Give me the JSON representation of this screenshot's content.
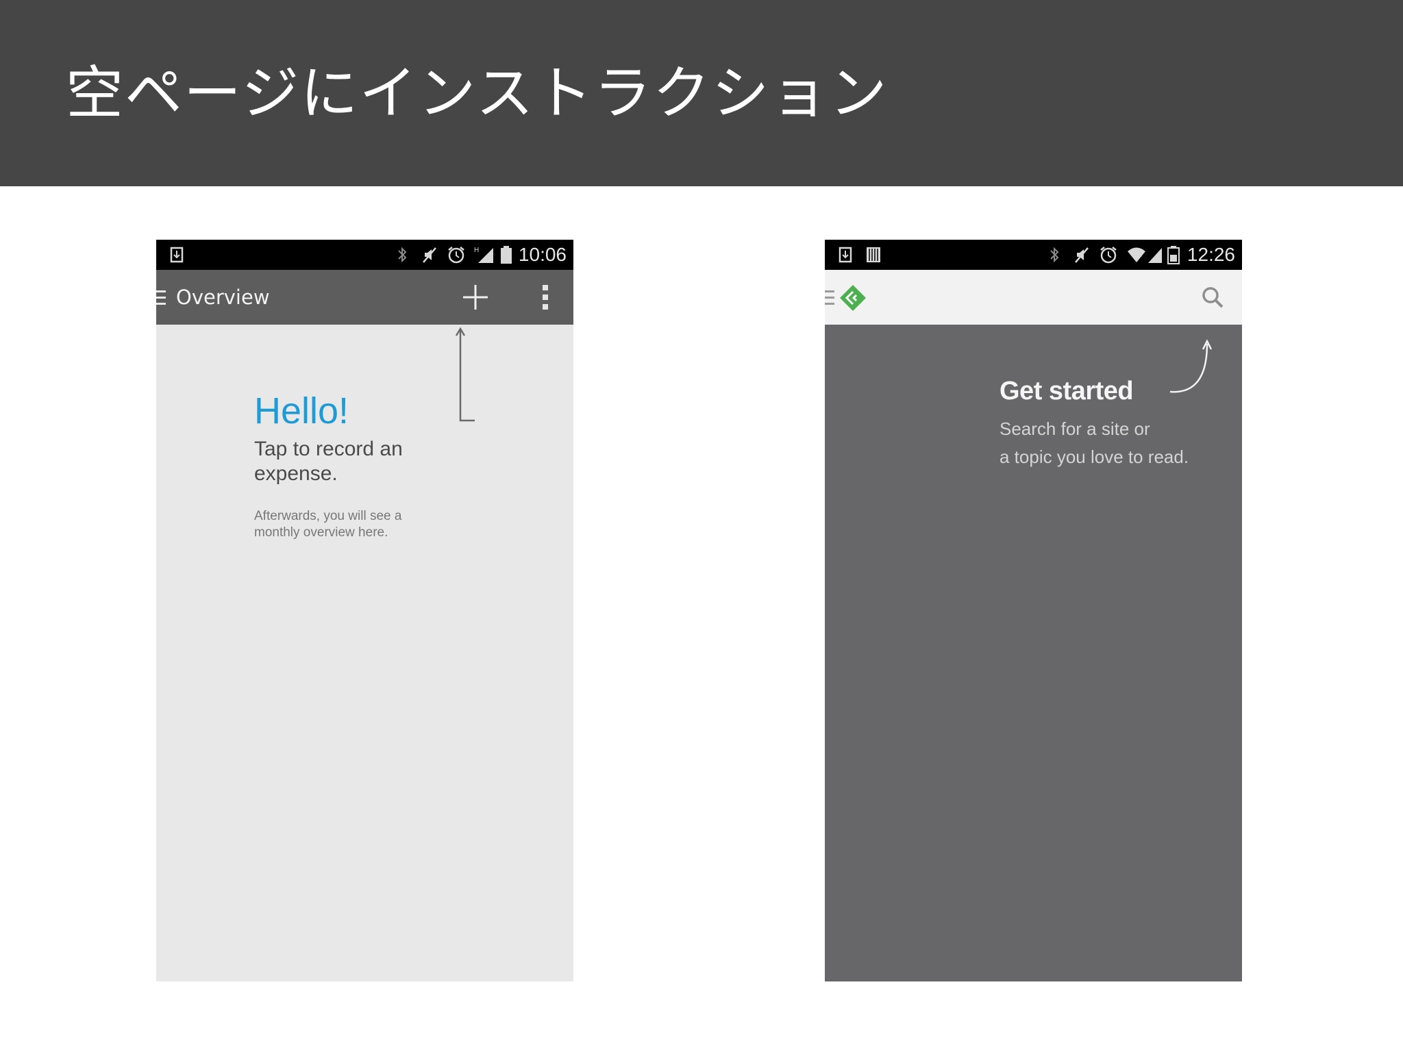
{
  "slide": {
    "title": "空ページにインストラクション",
    "header_bg": "#464646"
  },
  "left_phone": {
    "status_time": "10:06",
    "action_bar_title": "Overview",
    "icons": [
      "menu-icon",
      "plus-icon",
      "overflow-menu-icon",
      "download-icon",
      "bluetooth-icon",
      "mute-icon",
      "alarm-icon",
      "signal-icon",
      "battery-icon"
    ],
    "hello": "Hello!",
    "tap_text": "Tap to record an expense.",
    "after_text": "Afterwards, you will see a monthly overview here.",
    "colors": {
      "accent": "#1e9bd4",
      "background": "#e8e8e9",
      "action_bar": "#5d5d5e"
    }
  },
  "right_phone": {
    "status_time": "12:26",
    "icons": [
      "menu-icon",
      "feedly-logo-icon",
      "search-icon",
      "download-icon",
      "barcode-icon",
      "bluetooth-icon",
      "mute-icon",
      "alarm-icon",
      "wifi-icon",
      "signal-icon",
      "battery-icon"
    ],
    "get_started": "Get started",
    "search_line1": "Search for a site or",
    "search_line2": "a topic you love to read.",
    "colors": {
      "brand": "#4caf50",
      "background": "#676668",
      "action_bar": "#f2f2f2"
    }
  }
}
